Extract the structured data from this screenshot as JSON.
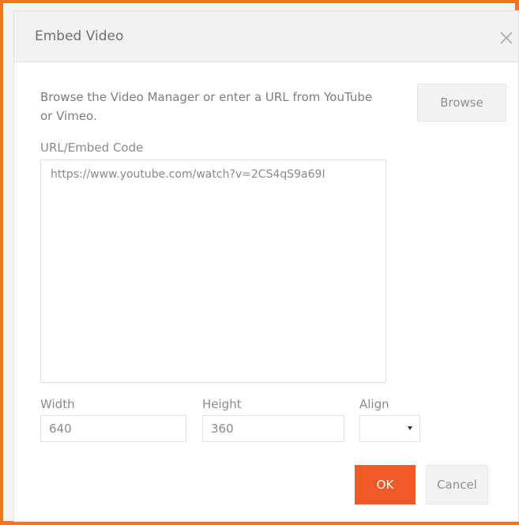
{
  "dialog": {
    "title": "Embed Video",
    "close_icon": "close-icon"
  },
  "instruction": "Browse the Video Manager or enter a URL from YouTube or Vimeo.",
  "browse_button": "Browse",
  "url_field": {
    "label": "URL/Embed Code",
    "value": "https://www.youtube.com/watch?v=2CS4qS9a69I"
  },
  "width_field": {
    "label": "Width",
    "value": "640"
  },
  "height_field": {
    "label": "Height",
    "value": "360"
  },
  "align_field": {
    "label": "Align",
    "value": ""
  },
  "buttons": {
    "ok": "OK",
    "cancel": "Cancel"
  },
  "colors": {
    "frame_border": "#ef7426",
    "ok_button": "#ef5a28",
    "titlebar": "#f2f2f2"
  }
}
